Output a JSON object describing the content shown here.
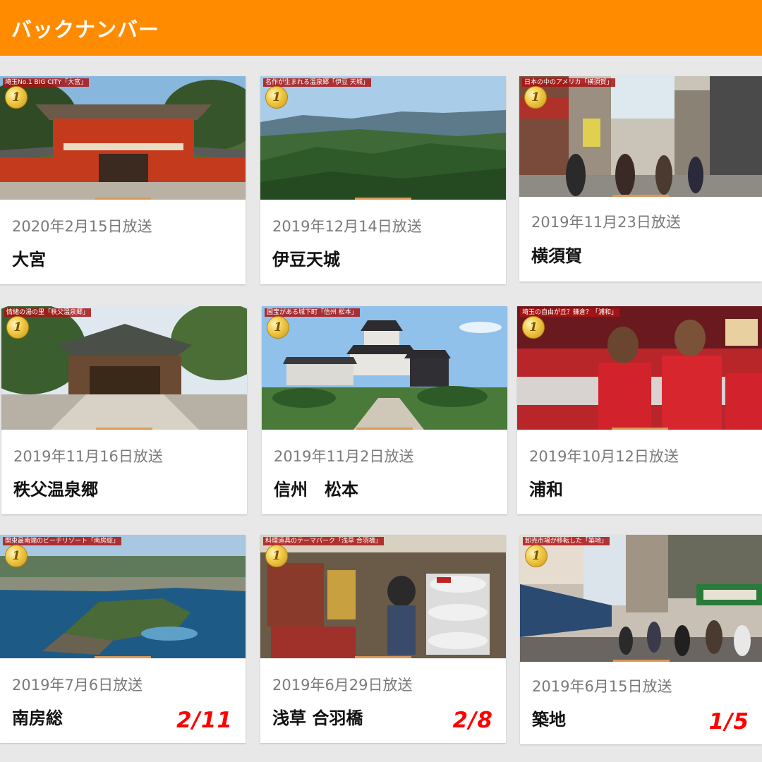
{
  "header": {
    "title": "バックナンバー"
  },
  "cards": [
    {
      "caption": "埼玉No.1 BIG CITY「大宮」",
      "medal": "1",
      "date": "2020年2月15日放送",
      "name": "大宮",
      "count": "",
      "image": "shrine-gate"
    },
    {
      "caption": "名作が生まれる温泉郷「伊豆 天城」",
      "medal": "1",
      "date": "2019年12月14日放送",
      "name": "伊豆天城",
      "count": "",
      "image": "mountain-landscape"
    },
    {
      "caption": "日本の中のアメリカ「横須賀」",
      "medal": "1",
      "date": "2019年11月23日放送",
      "name": "横須賀",
      "count": "",
      "image": "shopping-street"
    },
    {
      "caption": "情緒の湯の里「秩父温泉郷」",
      "medal": "1",
      "date": "2019年11月16日放送",
      "name": "秩父温泉郷",
      "count": "",
      "image": "shrine-hall"
    },
    {
      "caption": "国宝がある城下町「信州 松本」",
      "medal": "1",
      "date": "2019年11月2日放送",
      "name": "信州　松本",
      "count": "",
      "image": "castle"
    },
    {
      "caption": "埼玉の自由が丘？鎌倉？「浦和」",
      "medal": "1",
      "date": "2019年10月12日放送",
      "name": "浦和",
      "count": "",
      "image": "soccer-players"
    },
    {
      "caption": "関東最南端のビーチリゾート「南房総」",
      "medal": "1",
      "date": "2019年7月6日放送",
      "name": "南房総",
      "count": "2/11",
      "image": "coastline"
    },
    {
      "caption": "料理道具のテーマパーク「浅草 合羽橋」",
      "medal": "1",
      "date": "2019年6月29日放送",
      "name": "浅草 合羽橋",
      "count": "2/8",
      "image": "kitchen-shop"
    },
    {
      "caption": "卸売市場が移転した「築地」",
      "medal": "1",
      "date": "2019年6月15日放送",
      "name": "築地",
      "count": "1/5",
      "image": "market-street"
    }
  ],
  "colors": {
    "header": "#ff8c00",
    "count": "#ff0000",
    "background": "#e8e8e8"
  }
}
